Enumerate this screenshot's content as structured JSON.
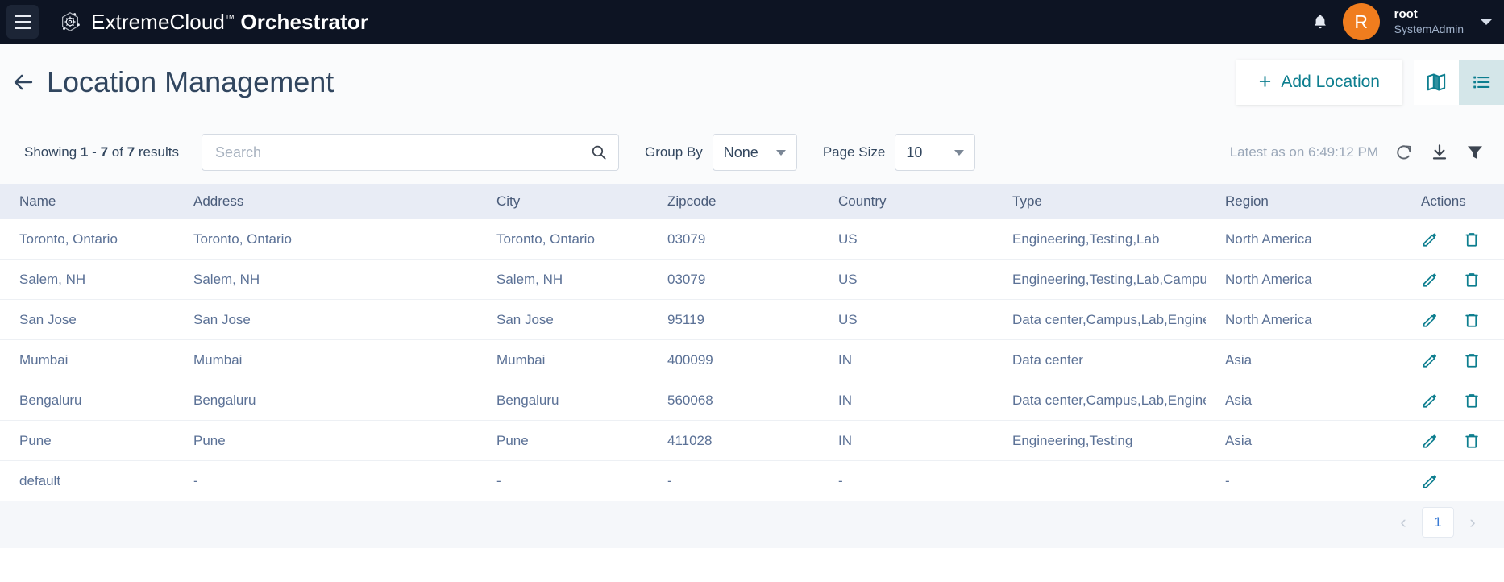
{
  "topbar": {
    "menu_icon": "hamburger-icon",
    "brand_logo_icon": "extreme-atom-gear-icon",
    "brand_prefix": "ExtremeCloud",
    "brand_tm": "™",
    "brand_suffix": "Orchestrator",
    "notification_icon": "bell-icon",
    "avatar_initial": "R",
    "user_name": "root",
    "user_role": "SystemAdmin",
    "account_caret_icon": "chevron-down-icon",
    "bg_color": "#0d1423",
    "avatar_color": "#f07d1e"
  },
  "page_header": {
    "back_icon": "arrow-left-icon",
    "title": "Location Management",
    "add_button_label": "Add Location",
    "add_button_plus": "+",
    "map_view_icon": "map-icon",
    "list_view_icon": "list-icon",
    "active_view": "list",
    "accent_color": "#0d7e8f",
    "active_bg": "#d4e6e9"
  },
  "toolbar": {
    "showing_prefix": "Showing",
    "showing_from": "1",
    "showing_dash": "-",
    "showing_to": "7",
    "showing_of": "of",
    "showing_total": "7",
    "showing_suffix": "results",
    "search_placeholder": "Search",
    "search_value": "",
    "search_icon": "search-icon",
    "group_by_label": "Group By",
    "group_by_value": "None",
    "page_size_label": "Page Size",
    "page_size_value": "10",
    "latest_text": "Latest as on 6:49:12 PM",
    "refresh_icon": "refresh-icon",
    "download_icon": "download-icon",
    "filter_icon": "filter-icon"
  },
  "table": {
    "columns": [
      "Name",
      "Address",
      "City",
      "Zipcode",
      "Country",
      "Type",
      "Region",
      "Actions"
    ],
    "rows": [
      {
        "name": "Toronto, Ontario",
        "address": "Toronto, Ontario",
        "city": "Toronto, Ontario",
        "zipcode": "03079",
        "country": "US",
        "type": "Engineering,Testing,Lab",
        "region": "North America",
        "has_edit": true,
        "has_delete": true
      },
      {
        "name": "Salem, NH",
        "address": "Salem, NH",
        "city": "Salem, NH",
        "zipcode": "03079",
        "country": "US",
        "type": "Engineering,Testing,Lab,Campus",
        "region": "North America",
        "has_edit": true,
        "has_delete": true
      },
      {
        "name": "San Jose",
        "address": "San Jose",
        "city": "San Jose",
        "zipcode": "95119",
        "country": "US",
        "type": "Data center,Campus,Lab,Engineering",
        "region": "North America",
        "has_edit": true,
        "has_delete": true
      },
      {
        "name": "Mumbai",
        "address": "Mumbai",
        "city": "Mumbai",
        "zipcode": "400099",
        "country": "IN",
        "type": "Data center",
        "region": "Asia",
        "has_edit": true,
        "has_delete": true
      },
      {
        "name": "Bengaluru",
        "address": "Bengaluru",
        "city": "Bengaluru",
        "zipcode": "560068",
        "country": "IN",
        "type": "Data center,Campus,Lab,Engineering",
        "region": "Asia",
        "has_edit": true,
        "has_delete": true
      },
      {
        "name": "Pune",
        "address": "Pune",
        "city": "Pune",
        "zipcode": "411028",
        "country": "IN",
        "type": "Engineering,Testing",
        "region": "Asia",
        "has_edit": true,
        "has_delete": true
      },
      {
        "name": "default",
        "address": "-",
        "city": "-",
        "zipcode": "-",
        "country": "-",
        "type": "",
        "region": "-",
        "has_edit": true,
        "has_delete": false
      }
    ],
    "edit_icon": "pencil-icon",
    "delete_icon": "trash-icon",
    "icon_color": "#0d7e8f"
  },
  "pagination": {
    "prev_icon": "chevron-left-icon",
    "next_icon": "chevron-right-icon",
    "pages": [
      "1"
    ],
    "current_page": "1"
  }
}
